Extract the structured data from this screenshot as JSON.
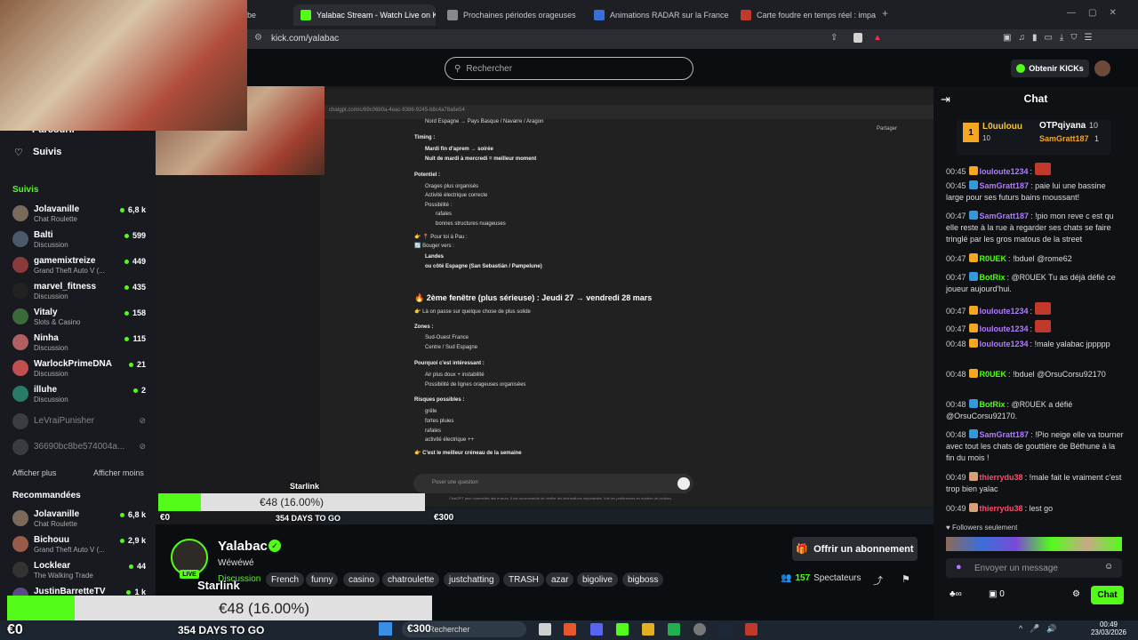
{
  "browser": {
    "tabs": [
      {
        "label": "be",
        "active": false
      },
      {
        "label": "Yalabac Stream - Watch Live on K",
        "active": true
      },
      {
        "label": "Prochaines périodes orageuses",
        "active": false
      },
      {
        "label": "Animations RADAR sur la France pa",
        "active": false
      },
      {
        "label": "Carte foudre en temps réel : impact",
        "active": false
      }
    ],
    "url": "kick.com/yalabac"
  },
  "header": {
    "search_placeholder": "Rechercher",
    "kicks_button": "Obtenir KICKs"
  },
  "sidebar": {
    "nav_partial": "Parcourir",
    "following_nav": "Suivis",
    "followed_title": "Suivis",
    "followed": [
      {
        "name": "Jolavanille",
        "category": "Chat Roulette",
        "viewers": "6,8 k"
      },
      {
        "name": "Balti",
        "category": "Discussion",
        "viewers": "599"
      },
      {
        "name": "gamemixtreize",
        "category": "Grand Theft Auto V (...",
        "viewers": "449"
      },
      {
        "name": "marvel_fitness",
        "category": "Discussion",
        "viewers": "435"
      },
      {
        "name": "Vitaly",
        "category": "Slots & Casino",
        "viewers": "158"
      },
      {
        "name": "Ninha",
        "category": "Discussion",
        "viewers": "115"
      },
      {
        "name": "WarlockPrimeDNA",
        "category": "Discussion",
        "viewers": "21"
      },
      {
        "name": "illuhe",
        "category": "Discussion",
        "viewers": "2"
      }
    ],
    "offline": [
      {
        "name": "LeVraiPunisher"
      },
      {
        "name": "36690bc8be574004a..."
      }
    ],
    "show_more": "Afficher plus",
    "show_less": "Afficher moins",
    "recommended_title": "Recommandées",
    "recommended": [
      {
        "name": "Jolavanille",
        "category": "Chat Roulette",
        "viewers": "6,8 k"
      },
      {
        "name": "Bichouu",
        "category": "Grand Theft Auto V (...",
        "viewers": "2,9 k"
      },
      {
        "name": "Locklear",
        "category": "The Walking Trade",
        "viewers": "44"
      },
      {
        "name": "JustinBarretteTV",
        "category": "",
        "viewers": "1 k"
      }
    ]
  },
  "stream_overlay": {
    "inner_url": "chatgpt.com/c/69c06b0a-4eac-8386-9245-b8c4a78a6e54",
    "share_label": "Partager",
    "doc_lines": [
      "Nord Espagne → Pays Basque / Navarre / Aragon",
      "Timing :",
      "Mardi fin d'aprem → soirée",
      "Nuit de mardi à mercredi = meilleur moment",
      "Potentiel :",
      "Orages plus organisés",
      "Activité électrique correcte",
      "Possibilité :",
      "rafales",
      "bonnes structures nuageuses",
      "👉 📍 Pour toi à Pau :",
      "🔄 Bouger vers :",
      "Landes",
      "ou côté Espagne (San Sebastián / Pampelune)"
    ],
    "doc_heading": "🔥 2ème fenêtre (plus sérieuse) : Jeudi 27 → vendredi 28 mars",
    "doc_lines2": [
      "👉 Là on passe sur quelque chose de plus solide",
      "Zones :",
      "Sud-Ouest France",
      "Centre / Sud Espagne",
      "Pourquoi c'est intéressant :",
      "Air plus doux + instabilité",
      "Possibilité de lignes orageuses organisées",
      "Risques possibles :",
      "grêle",
      "fortes pluies",
      "rafales",
      "activité électrique ++",
      "👉 C'est le meilleur créneau de la semaine"
    ],
    "prompt_placeholder": "Poser une question",
    "disclaimer": "ChatGPT peut commettre des erreurs. Il est recommandé de vérifier les informations importantes. Voir les préférences en matière de cookies.",
    "goal_small": {
      "label": "Starlink",
      "amount": "€48 (16.00%)",
      "current": "€0",
      "target": "€300",
      "days": "354 DAYS TO GO",
      "progress": 0.16
    }
  },
  "stream_info": {
    "name": "Yalabac",
    "title": "Wéwéwé",
    "live_label": "LIVE",
    "category": "Discussion",
    "tags": [
      "French",
      "funny",
      "casino",
      "chatroulette",
      "justchatting",
      "TRASH",
      "azar",
      "bigolive",
      "bigboss"
    ],
    "subscribe_button": "Offrir un abonnement",
    "viewers_count": "157",
    "viewers_label": "Spectateurs"
  },
  "chat": {
    "title": "Chat",
    "leaderboard": [
      {
        "rank": "1",
        "name": "L0uulouu",
        "points": "10"
      },
      {
        "name": "OTPqiyana",
        "points": "10"
      },
      {
        "name": "SamGratt187",
        "points": "1"
      }
    ],
    "messages": [
      {
        "time": "00:45",
        "user": "louloute1234",
        "color": "#b07cff",
        "text": ""
      },
      {
        "time": "00:45",
        "user": "SamGratt187",
        "color": "#b07cff",
        "text": "paie lui une bassine large pour ses futurs bains moussant!"
      },
      {
        "time": "00:47",
        "user": "SamGratt187",
        "color": "#b07cff",
        "text": "!pio mon reve c est qu elle reste à la rue à regarder ses chats se faire tringlé par les gros matous de la street"
      },
      {
        "time": "00:47",
        "user": "R0UEK",
        "color": "#53fc18",
        "text": "!bduel @rome62"
      },
      {
        "time": "00:47",
        "user": "BotRix",
        "color": "#53fc18",
        "text": "@R0UEK Tu as déjà défié ce joueur aujourd'hui."
      },
      {
        "time": "00:47",
        "user": "louloute1234",
        "color": "#b07cff",
        "text": ""
      },
      {
        "time": "00:47",
        "user": "louloute1234",
        "color": "#b07cff",
        "text": ""
      },
      {
        "time": "00:48",
        "user": "louloute1234",
        "color": "#b07cff",
        "text": "!male yalabac jppppp"
      },
      {
        "time": "00:48",
        "user": "R0UEK",
        "color": "#53fc18",
        "text": "!bduel @OrsuCorsu92170"
      },
      {
        "time": "00:48",
        "user": "BotRix",
        "color": "#53fc18",
        "text": "@R0UEK a défié @OrsuCorsu92170."
      },
      {
        "time": "00:48",
        "user": "SamGratt187",
        "color": "#b07cff",
        "text": "!Pio neige elle va tourner avec tout les chats de gouttière de Béthune à la fin du mois !"
      },
      {
        "time": "00:49",
        "user": "thierrydu38",
        "color": "#ff4d6d",
        "text": "!male fait le vraiment c'est trop bien yalac"
      },
      {
        "time": "00:49",
        "user": "thierrydu38",
        "color": "#ff4d6d",
        "text": "lest go"
      }
    ],
    "followers_only": "Followers seulement",
    "input_placeholder": "Envoyer un message",
    "points": "0",
    "send_button": "Chat"
  },
  "goal_big": {
    "label": "Starlink",
    "amount": "€48 (16.00%)",
    "current": "€0",
    "target": "€300",
    "days": "354 DAYS TO GO",
    "progress": 0.16
  },
  "taskbar": {
    "search_label": "Rechercher",
    "time": "00:49",
    "date": "23/03/2026"
  }
}
